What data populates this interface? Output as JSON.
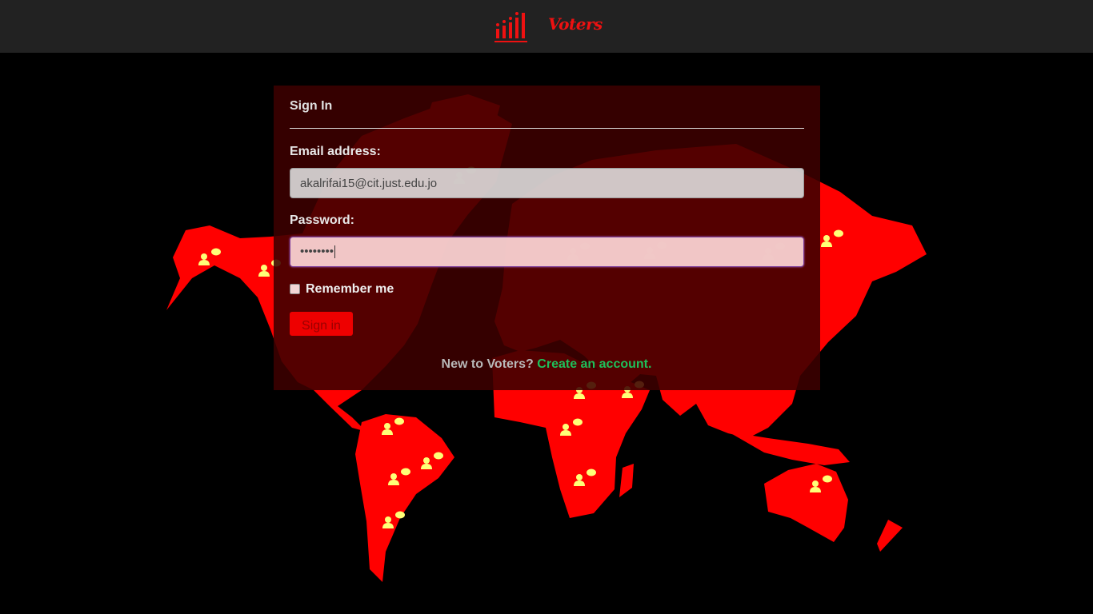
{
  "app": {
    "brand_name": "Voters",
    "brand_color": "#ee1111",
    "topbar_color": "#222222"
  },
  "icons": {
    "logo": "bar-chart-logo-icon",
    "voter": "person-speech-bubble-icon"
  },
  "form": {
    "title": "Sign In",
    "email_label": "Email address:",
    "email_value": "akalrifai15@cit.just.edu.jo",
    "password_label": "Password:",
    "password_mask": "••••••••",
    "remember_label": "Remember me",
    "remember_checked": false,
    "submit_label": "Sign in"
  },
  "footer": {
    "prompt": "New to Voters?",
    "link_text": "Create an account.",
    "link_color": "#1ec05a"
  },
  "colors": {
    "accent": "#ee0000",
    "map_fill": "#ff0000",
    "marker": "#ffff77",
    "background": "#000000"
  }
}
